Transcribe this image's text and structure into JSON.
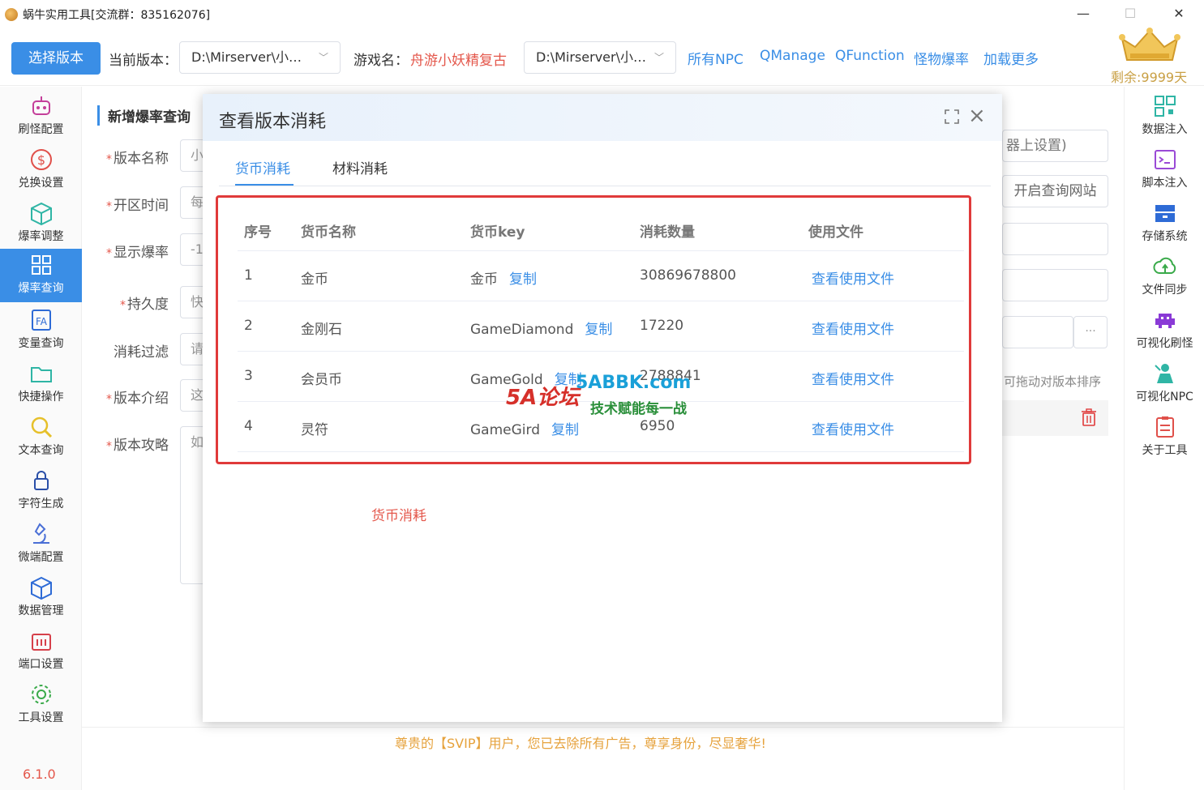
{
  "window": {
    "title": "蜗牛实用工具[交流群：835162076]",
    "minimize": "—",
    "maximize": "☐",
    "close": "✕"
  },
  "toolbar": {
    "select_version_btn": "选择版本",
    "current_version_label": "当前版本：",
    "current_version_value": "D:\\Mirserver\\小…",
    "game_name_label": "游戏名：",
    "game_name_value": "舟游小妖精复古",
    "path_value": "D:\\Mirserver\\小…",
    "links": [
      "所有NPC",
      "QManage",
      "QFunction",
      "怪物爆率",
      "加载更多"
    ],
    "remaining": "剩余:9999天"
  },
  "sidebar": {
    "items": [
      {
        "label": "刷怪配置",
        "icon": "robot-icon"
      },
      {
        "label": "兑换设置",
        "icon": "dollar-icon"
      },
      {
        "label": "爆率调整",
        "icon": "cube-icon"
      },
      {
        "label": "爆率查询",
        "icon": "grid-query-icon"
      },
      {
        "label": "变量查询",
        "icon": "variable-icon"
      },
      {
        "label": "快捷操作",
        "icon": "folder-icon"
      },
      {
        "label": "文本查询",
        "icon": "search-icon"
      },
      {
        "label": "字符生成",
        "icon": "lock-icon"
      },
      {
        "label": "微端配置",
        "icon": "microscope-icon"
      },
      {
        "label": "数据管理",
        "icon": "box-icon"
      },
      {
        "label": "端口设置",
        "icon": "port-icon"
      },
      {
        "label": "工具设置",
        "icon": "gear-icon"
      }
    ],
    "active_index": 3,
    "version": "6.1.0"
  },
  "rsidebar": {
    "items": [
      {
        "label": "数据注入",
        "icon": "qrcode-icon"
      },
      {
        "label": "脚本注入",
        "icon": "terminal-icon"
      },
      {
        "label": "存储系统",
        "icon": "storage-icon"
      },
      {
        "label": "文件同步",
        "icon": "cloud-sync-icon"
      },
      {
        "label": "可视化刷怪",
        "icon": "invader-icon"
      },
      {
        "label": "可视化NPC",
        "icon": "npc-icon"
      },
      {
        "label": "关于工具",
        "icon": "clipboard-icon"
      }
    ]
  },
  "form": {
    "section_title": "新增爆率查询",
    "fields": [
      {
        "label": "版本名称",
        "required": true,
        "value": "小"
      },
      {
        "label": "开区时间",
        "required": true,
        "value": "每"
      },
      {
        "label": "显示爆率",
        "required": true,
        "value": "-1"
      },
      {
        "label": "持久度",
        "required": true,
        "value": "快"
      },
      {
        "label": "消耗过滤",
        "required": false,
        "value": "请"
      },
      {
        "label": "版本介绍",
        "required": true,
        "value": "这"
      },
      {
        "label": "版本攻略",
        "required": true,
        "value": "如"
      }
    ],
    "right_input_1": "器上设置)",
    "right_button": "开启查询网站",
    "drag_hint": "可拖动对版本排序",
    "dots": "···"
  },
  "footer": {
    "text": "尊贵的【SVIP】用户，您已去除所有广告，尊享身份，尽显奢华!"
  },
  "modal": {
    "title": "查看版本消耗",
    "tabs": [
      "货币消耗",
      "材料消耗"
    ],
    "active_tab": 0,
    "columns": [
      "序号",
      "货币名称",
      "货币key",
      "消耗数量",
      "使用文件"
    ],
    "copy_label": "复制",
    "rows": [
      {
        "no": "1",
        "name": "金币",
        "key": "金币",
        "count": "30869678800",
        "file": "查看使用文件"
      },
      {
        "no": "2",
        "name": "金刚石",
        "key": "GameDiamond",
        "count": "17220",
        "file": "查看使用文件"
      },
      {
        "no": "3",
        "name": "会员币",
        "key": "GameGold",
        "count": "2788841",
        "file": "查看使用文件"
      },
      {
        "no": "4",
        "name": "灵符",
        "key": "GameGird",
        "count": "6950",
        "file": "查看使用文件"
      }
    ],
    "bottom_label": "货币消耗"
  },
  "watermark": {
    "brand": "5A论坛",
    "domain": "5ABBK.com",
    "slogan": "技术赋能每一战"
  },
  "colors": {
    "accent": "#3a8ee6",
    "danger": "#e03a3a",
    "warning": "#e6a23c"
  }
}
